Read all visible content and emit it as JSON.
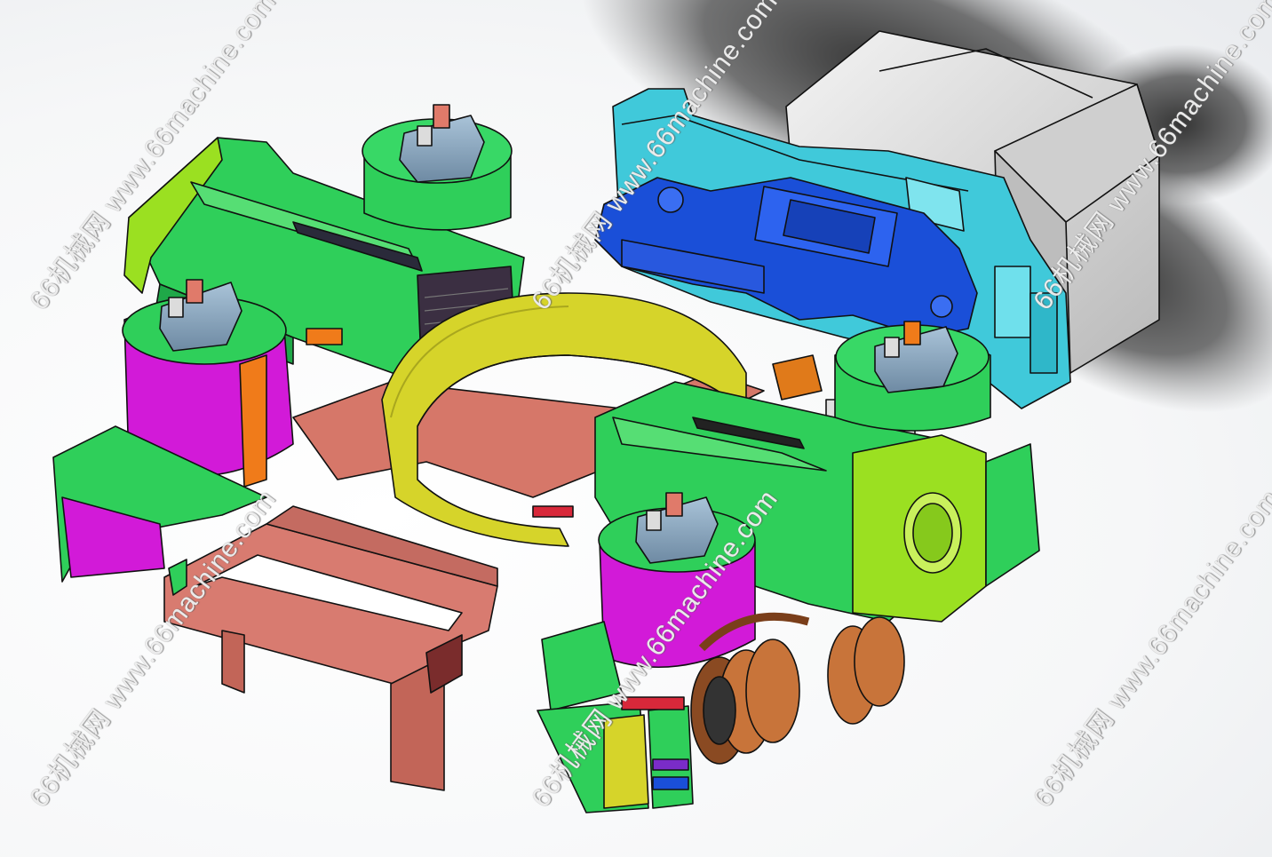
{
  "scene": {
    "description_hidden": "",
    "colors": {
      "green": "#2fcf5a",
      "green_dark": "#1a9a3a",
      "lime": "#9be021",
      "magenta": "#d21ad8",
      "salmon": "#d97a6e",
      "yellow": "#d6d42a",
      "cyan": "#3cc9d8",
      "blue": "#1a4fd8",
      "gray": "#d3d3d3",
      "copper": "#c8743a",
      "slate": "#8aa6bf",
      "dark": "#3a2f3f",
      "outline": "#111111"
    }
  },
  "watermarks": [
    {
      "text": "66机械网 www.66machine.com"
    },
    {
      "text": "66机械网 www.66machine.com"
    },
    {
      "text": "66机械网 www.66machine.com"
    },
    {
      "text": "66机械网 www.66machine.com"
    },
    {
      "text": "66机械网 www.66machine.com"
    },
    {
      "text": "66机械网 www.66machine.com"
    }
  ]
}
